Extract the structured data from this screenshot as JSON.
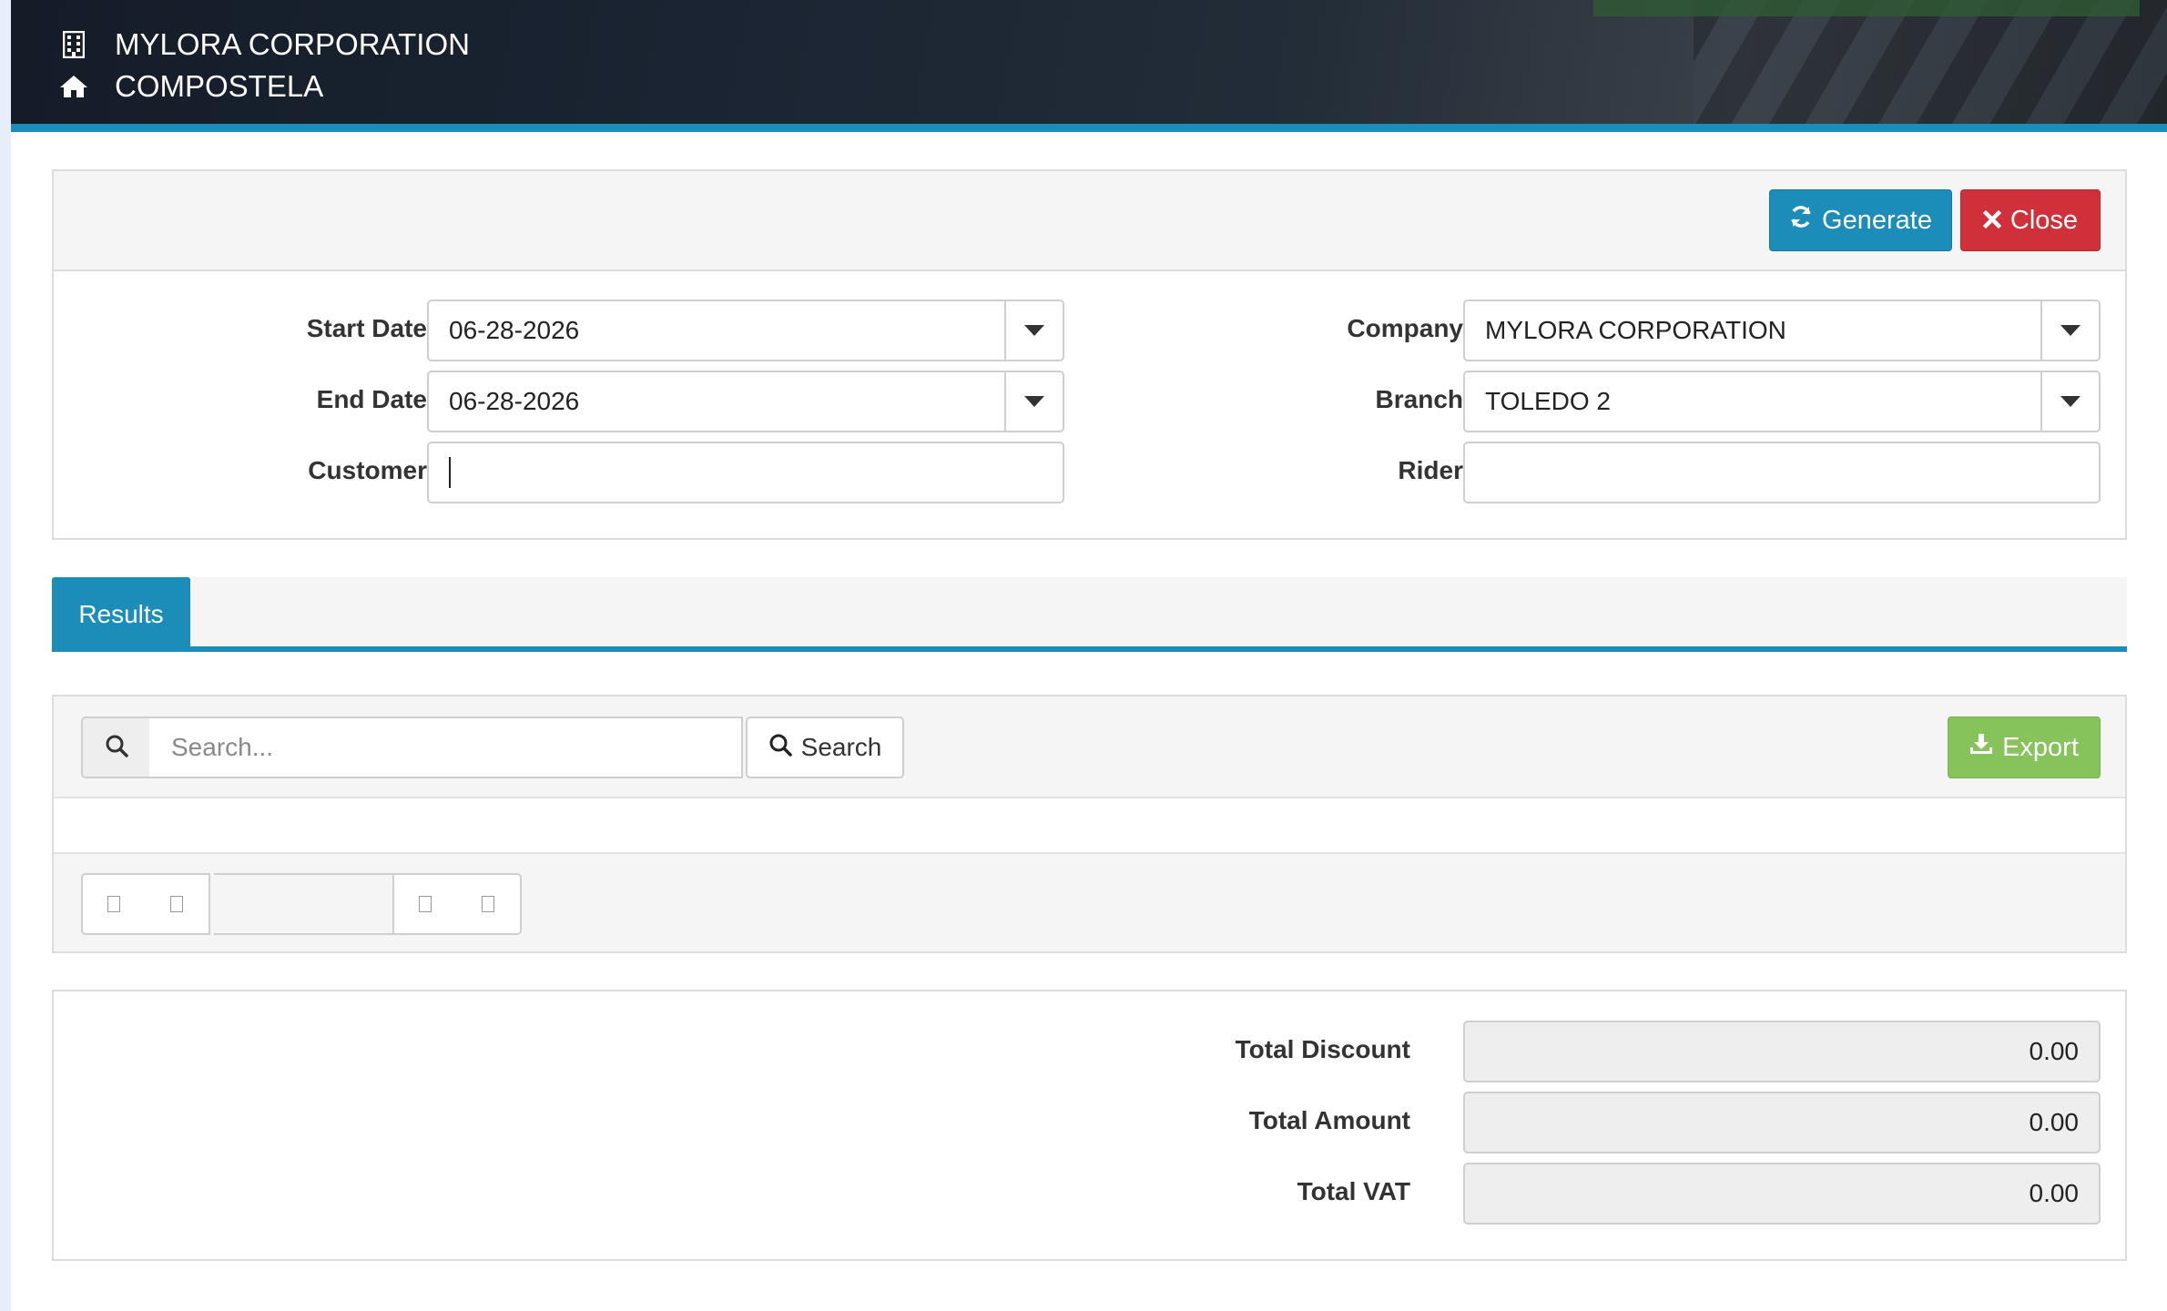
{
  "header": {
    "company": "MYLORA CORPORATION",
    "branch": "COMPOSTELA"
  },
  "toolbar": {
    "generate_label": "Generate",
    "close_label": "Close"
  },
  "filters": {
    "start_date": {
      "label": "Start Date",
      "value": "06-28-2026"
    },
    "end_date": {
      "label": "End Date",
      "value": "06-28-2026"
    },
    "customer": {
      "label": "Customer",
      "value": ""
    },
    "company": {
      "label": "Company",
      "value": "MYLORA CORPORATION"
    },
    "branch": {
      "label": "Branch",
      "value": "TOLEDO 2"
    },
    "rider": {
      "label": "Rider",
      "value": ""
    }
  },
  "tabs": [
    {
      "label": "Results"
    }
  ],
  "results": {
    "search_placeholder": "Search...",
    "search_label": "Search",
    "export_label": "Export"
  },
  "totals": {
    "discount": {
      "label": "Total Discount",
      "value": "0.00"
    },
    "amount": {
      "label": "Total Amount",
      "value": "0.00"
    },
    "vat": {
      "label": "Total VAT",
      "value": "0.00"
    }
  },
  "colors": {
    "primary": "#1b8db8",
    "danger": "#d0303a",
    "success": "#86c35a"
  }
}
